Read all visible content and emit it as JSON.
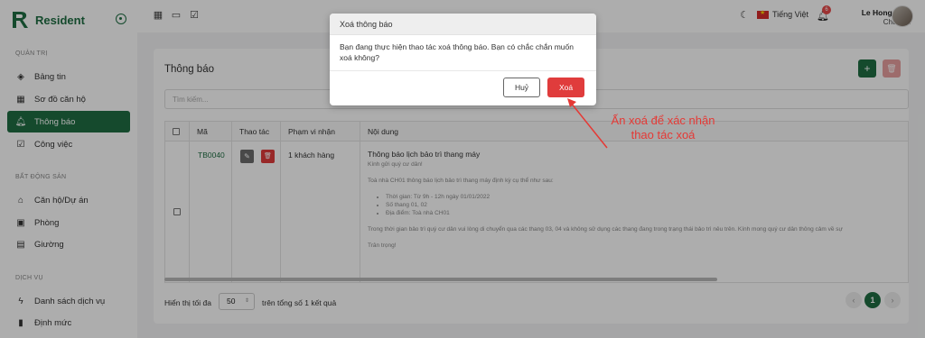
{
  "app": {
    "name": "Resident"
  },
  "sidebar": {
    "sections": [
      {
        "title": "QUẢN TRỊ",
        "items": [
          {
            "label": "Bảng tin",
            "icon": "layers-icon"
          },
          {
            "label": "Sơ đồ căn hộ",
            "icon": "grid-icon"
          },
          {
            "label": "Thông báo",
            "icon": "bell-icon",
            "active": true
          },
          {
            "label": "Công việc",
            "icon": "checklist-icon"
          }
        ]
      },
      {
        "title": "BẤT ĐỘNG SẢN",
        "items": [
          {
            "label": "Căn hộ/Dự án",
            "icon": "building-icon"
          },
          {
            "label": "Phòng",
            "icon": "rooms-icon"
          },
          {
            "label": "Giường",
            "icon": "bed-icon"
          }
        ]
      },
      {
        "title": "DỊCH VỤ",
        "items": [
          {
            "label": "Danh sách dịch vụ",
            "icon": "lightning-icon"
          },
          {
            "label": "Định mức",
            "icon": "bar-chart-icon"
          }
        ]
      }
    ]
  },
  "topbar": {
    "language": "Tiếng Việt",
    "notification_count": "6",
    "user_name": "Le Hong Linh",
    "user_role": "Chủ nhà"
  },
  "page": {
    "title": "Thông báo",
    "search_placeholder": "Tìm kiếm...",
    "table": {
      "headers": [
        "Mã",
        "Thao tác",
        "Phạm vi nhận",
        "Nội dung"
      ],
      "rows": [
        {
          "code": "TB0040",
          "scope": "1 khách hàng",
          "content_title": "Thông báo lịch bảo trì thang máy",
          "greeting": "Kính gửi quý cư dân!",
          "intro": "Toà nhà CH01 thông báo lịch bảo trì thang máy định kỳ cụ thể như sau:",
          "bullets": [
            "Thời gian: Từ 9h - 12h ngày 01/01/2022",
            "Số thang 01, 02",
            "Địa điểm: Toà nhà CH01"
          ],
          "notice": "Trong thời gian bảo trì quý cư dân vui lòng di chuyển qua các thang 03, 04 và không sử dụng các thang đang trong trạng thái bảo trì nêu trên. Kính mong quý cư dân thông cảm về sự",
          "closing": "Trân trọng!"
        }
      ]
    },
    "footer": {
      "show_label": "Hiển thị tối đa",
      "per_page": "50",
      "total_label": "trên tổng số 1 kết quả",
      "current_page": "1"
    }
  },
  "modal": {
    "title": "Xoá thông báo",
    "message": "Bạn đang thực hiện thao tác xoá thông báo. Bạn có chắc chắn muốn xoá không?",
    "cancel_label": "Huỷ",
    "confirm_label": "Xoá"
  },
  "annotation": {
    "text": "Ấn xoá để xác nhận thao tác xoá"
  },
  "colors": {
    "brand": "#1f6e43",
    "danger": "#e03c3c",
    "annotation": "#e53935"
  }
}
